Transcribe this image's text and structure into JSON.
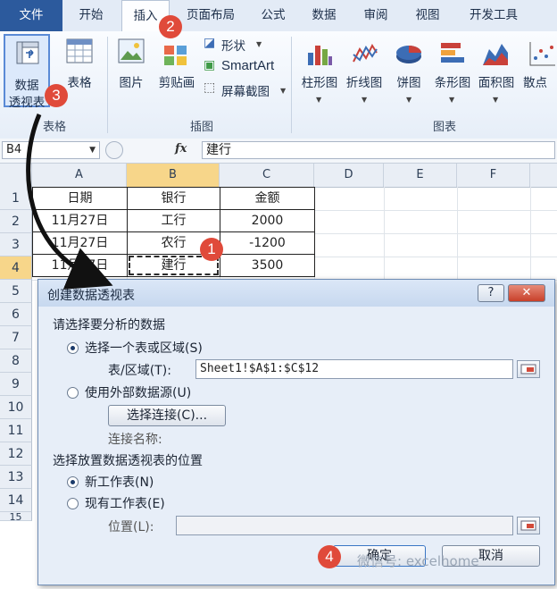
{
  "ribbon": {
    "tabs": [
      "文件",
      "开始",
      "插入",
      "页面布局",
      "公式",
      "数据",
      "审阅",
      "视图",
      "开发工具"
    ],
    "groups": {
      "tables": {
        "label": "表格",
        "pivot_line1": "数据",
        "pivot_line2": "透视表",
        "table_label": "表格"
      },
      "illustrations": {
        "label": "插图",
        "picture": "图片",
        "clipart": "剪贴画",
        "shapes": "形状",
        "smartart": "SmartArt",
        "screenshot": "屏幕截图"
      },
      "charts": {
        "label": "图表",
        "column": "柱形图",
        "line": "折线图",
        "pie": "饼图",
        "bar": "条形图",
        "area": "面积图",
        "scatter": "散点"
      }
    }
  },
  "formula_bar": {
    "name_box": "B4",
    "fx": "fx",
    "content": "建行"
  },
  "sheet": {
    "columns": [
      "A",
      "B",
      "C",
      "D",
      "E",
      "F"
    ],
    "rows": [
      "1",
      "2",
      "3",
      "4",
      "5",
      "6",
      "7",
      "8",
      "9",
      "10",
      "11",
      "12",
      "13",
      "14",
      "15"
    ],
    "header": [
      "日期",
      "银行",
      "金额"
    ],
    "data": [
      [
        "11月27日",
        "工行",
        "2000"
      ],
      [
        "11月27日",
        "农行",
        "-1200"
      ],
      [
        "11月27日",
        "建行",
        "3500"
      ]
    ]
  },
  "dialog": {
    "title": "创建数据透视表",
    "help": "?",
    "section1": "请选择要分析的数据",
    "opt_range": "选择一个表或区域(S)",
    "range_label": "表/区域(T):",
    "range_value": "Sheet1!$A$1:$C$12",
    "opt_external": "使用外部数据源(U)",
    "choose_conn": "选择连接(C)...",
    "conn_name": "连接名称:",
    "section2": "选择放置数据透视表的位置",
    "opt_new": "新工作表(N)",
    "opt_existing": "现有工作表(E)",
    "location_label": "位置(L):",
    "ok": "确定",
    "cancel": "取消"
  },
  "markers": [
    "1",
    "2",
    "3",
    "4"
  ],
  "watermark": "微信号: excelhome"
}
